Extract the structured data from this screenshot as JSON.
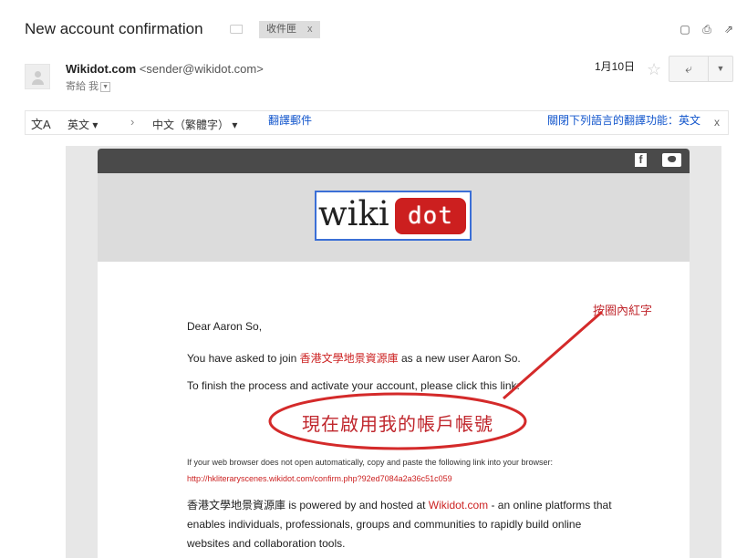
{
  "subject": "New account confirmation",
  "label": {
    "text": "收件匣",
    "remove": "x"
  },
  "top_icons": [
    "archive-icon",
    "print-icon",
    "popout-icon"
  ],
  "sender": {
    "name": "Wikidot.com",
    "email": "<sender@wikidot.com>",
    "recipient": "寄給 我"
  },
  "date": "1月10日",
  "translate_bar": {
    "from_lang": "英文",
    "to_lang": "中文（繁體字）",
    "translate_link": "翻譯郵件",
    "turn_off": "關閉下列語言的翻譯功能：英文",
    "close": "x"
  },
  "email": {
    "logo_wiki": "wiki",
    "logo_dot": "dot",
    "greeting": "Dear Aaron So,",
    "join_before": "You have asked to join ",
    "site_name": "香港文學地景資源庫",
    "join_after": " as a new user Aaron So.",
    "finish": "To finish the process and activate your account, please click this link:",
    "activate_link": "現在啟用我的帳戶帳號",
    "browser_note": "If your web browser does not open automatically, copy and paste the following link into your browser:",
    "confirm_url": "http://hkliteraryscenes.wikidot.com/confirm.php?92ed7084a2a36c51c059",
    "powered_site": "香港文學地景資源庫",
    "powered_text": " is powered by and hosted at ",
    "powered_link": "Wikidot.com",
    "powered_rest": " - an online platforms that enables individuals, professionals, groups and communities to rapidly build online websites and collaboration tools."
  },
  "annotation": "按圈內紅字",
  "colors": {
    "link_red": "#cc2222",
    "annotation_red": "#c0272d",
    "link_blue": "#1155cc"
  }
}
